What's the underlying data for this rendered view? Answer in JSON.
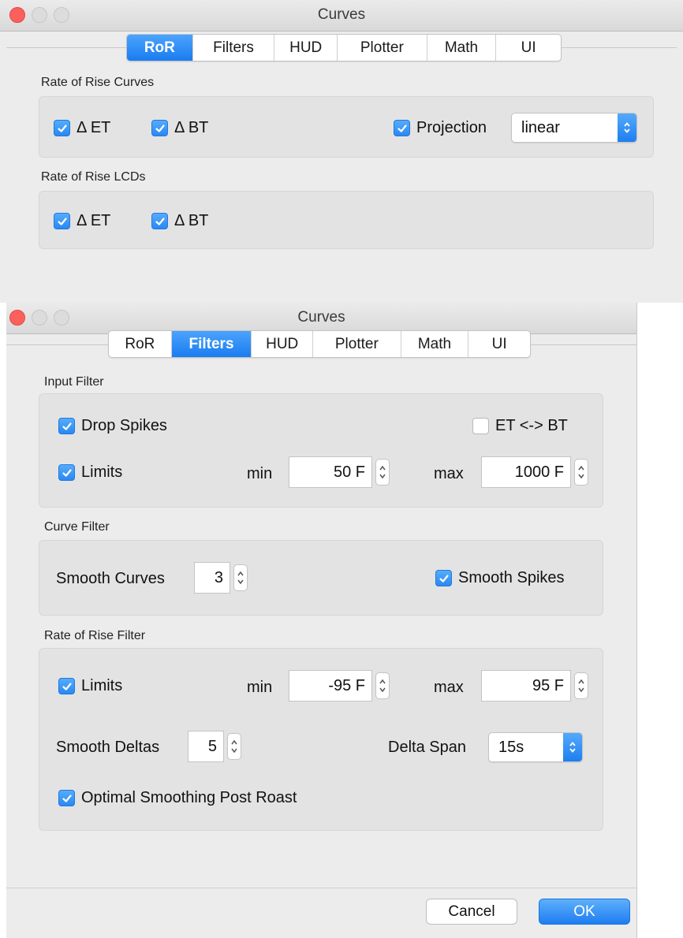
{
  "colors": {
    "accent": "#2a88f2",
    "close": "#fc605c",
    "window_bg": "#ececec",
    "group_bg": "#e3e3e3"
  },
  "window1": {
    "title": "Curves",
    "tabs": [
      "RoR",
      "Filters",
      "HUD",
      "Plotter",
      "Math",
      "UI"
    ],
    "active_tab": "RoR",
    "ror_curves": {
      "title": "Rate of Rise Curves",
      "delta_et": {
        "label": "Δ ET",
        "checked": true
      },
      "delta_bt": {
        "label": "Δ BT",
        "checked": true
      },
      "projection": {
        "label": "Projection",
        "checked": true
      },
      "projection_mode": "linear"
    },
    "ror_lcds": {
      "title": "Rate of Rise LCDs",
      "delta_et": {
        "label": "Δ ET",
        "checked": true
      },
      "delta_bt": {
        "label": "Δ BT",
        "checked": true
      }
    }
  },
  "window2": {
    "title": "Curves",
    "tabs": [
      "RoR",
      "Filters",
      "HUD",
      "Plotter",
      "Math",
      "UI"
    ],
    "active_tab": "Filters",
    "input_filter": {
      "title": "Input Filter",
      "drop_spikes": {
        "label": "Drop Spikes",
        "checked": true
      },
      "swap": {
        "label": "ET <-> BT",
        "checked": false
      },
      "limits": {
        "label": "Limits",
        "checked": true
      },
      "min_label": "min",
      "min_value": "50 F",
      "max_label": "max",
      "max_value": "1000 F"
    },
    "curve_filter": {
      "title": "Curve Filter",
      "smooth_curves_label": "Smooth Curves",
      "smooth_curves_value": "3",
      "smooth_spikes": {
        "label": "Smooth Spikes",
        "checked": true
      }
    },
    "ror_filter": {
      "title": "Rate of Rise Filter",
      "limits": {
        "label": "Limits",
        "checked": true
      },
      "min_label": "min",
      "min_value": "-95 F",
      "max_label": "max",
      "max_value": "95 F",
      "smooth_deltas_label": "Smooth Deltas",
      "smooth_deltas_value": "5",
      "delta_span_label": "Delta Span",
      "delta_span_value": "15s",
      "optimal_smoothing": {
        "label": "Optimal Smoothing Post Roast",
        "checked": true
      }
    },
    "buttons": {
      "cancel": "Cancel",
      "ok": "OK"
    }
  }
}
